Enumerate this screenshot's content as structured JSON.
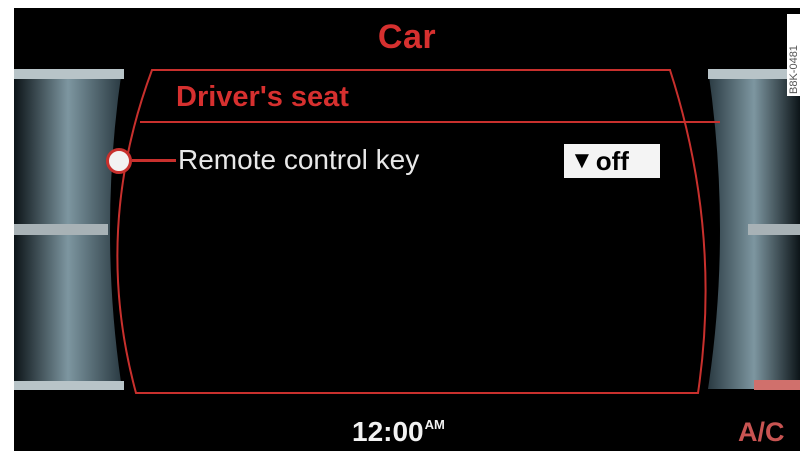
{
  "header": {
    "title": "Car"
  },
  "section": {
    "title": "Driver's seat"
  },
  "menu": {
    "items": [
      {
        "label": "Remote control key",
        "value": "off",
        "selected": true
      }
    ]
  },
  "dropdown": {
    "arrow": "▼"
  },
  "status_bar": {
    "time": "12:00",
    "meridiem": "AM",
    "ac_label": "A/C"
  },
  "watermark": {
    "code": "B8K-0481"
  },
  "colors": {
    "accent": "#d6302f",
    "text": "#e8e8e8",
    "background": "#000000"
  },
  "icons": [
    "radio-selected-icon",
    "dropdown-arrow-icon"
  ]
}
